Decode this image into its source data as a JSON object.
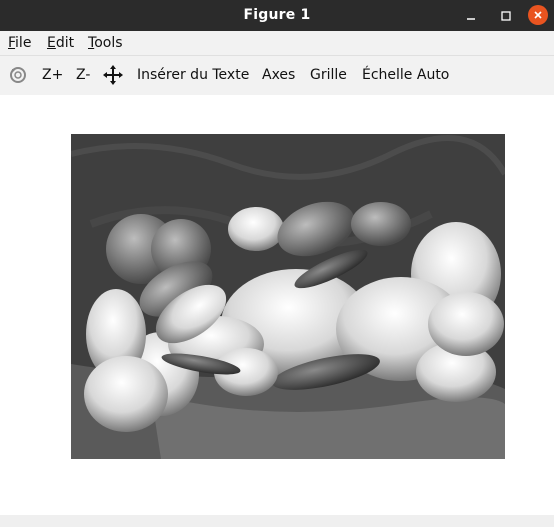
{
  "window": {
    "title": "Figure 1",
    "minimize_icon": "minimize-icon",
    "maximize_icon": "maximize-icon",
    "close_icon": "close-icon",
    "close_color": "#e95420"
  },
  "menu": [
    {
      "first": "F",
      "rest": "ile"
    },
    {
      "first": "E",
      "rest": "dit"
    },
    {
      "first": "T",
      "rest": "ools"
    }
  ],
  "toolbar": {
    "reset_icon": "reset-view-icon",
    "zoom_in": "Z+",
    "zoom_out": "Z-",
    "pan_icon": "pan-arrows-icon",
    "insert_text": "Insérer du Texte",
    "axes": "Axes",
    "grid": "Grille",
    "autoscale": "Échelle Auto"
  },
  "figure": {
    "image": "grayscale photo of bell peppers, chili peppers, onion and garlic on draped cloth"
  }
}
